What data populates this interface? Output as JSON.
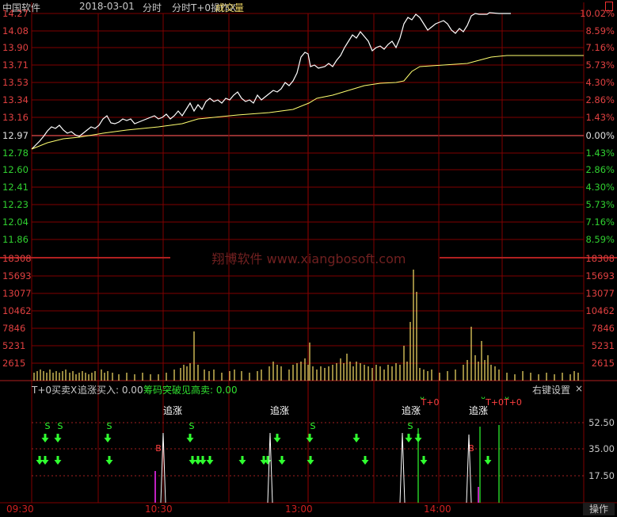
{
  "header": {
    "title": "中国软件",
    "date": "2018-03-01",
    "mode": "分时",
    "indicator": "分时T+0操作X",
    "volume_label": "成交量"
  },
  "colors": {
    "up": "#e04040",
    "down": "#30e030",
    "grid": "#8b0000",
    "price_line": "#ffffff",
    "avg_line": "#ffff70",
    "volume_bar": "#e8d060",
    "signal": "#30ff30"
  },
  "price_axis": {
    "left_labels": [
      "14.27",
      "14.08",
      "13.90",
      "13.71",
      "13.53",
      "13.34",
      "13.16",
      "12.97",
      "12.78",
      "12.60",
      "12.41",
      "12.23",
      "12.04",
      "11.86"
    ],
    "right_labels": [
      "10.02%",
      "8.59%",
      "7.16%",
      "5.73%",
      "4.30%",
      "2.86%",
      "1.43%",
      "0.00%",
      "1.43%",
      "2.86%",
      "4.30%",
      "5.73%",
      "7.16%",
      "8.59%"
    ],
    "prev_close": "12.97"
  },
  "volume_axis": {
    "labels": [
      "18308",
      "15693",
      "13077",
      "10462",
      "7846",
      "5231",
      "2615"
    ]
  },
  "watermark": "翔博软件 www.xiangbosoft.com",
  "sub_panel": {
    "name": "T+0买卖X",
    "chase_label": "追涨买入: 0.00",
    "breakout_label": "筹码突破见高卖: 0.00",
    "right_settings": "右键设置",
    "close_glyph": "×",
    "axis_labels": [
      "52.50",
      "35.00",
      "17.50"
    ],
    "chase_text": "追涨",
    "s_text": "S",
    "b_text": "B",
    "t0_text": "T+0",
    "t0_double": "T+0T+0"
  },
  "time_axis": [
    "09:30",
    "10:30",
    "13:00",
    "14:00"
  ],
  "operate_button": "操作"
}
